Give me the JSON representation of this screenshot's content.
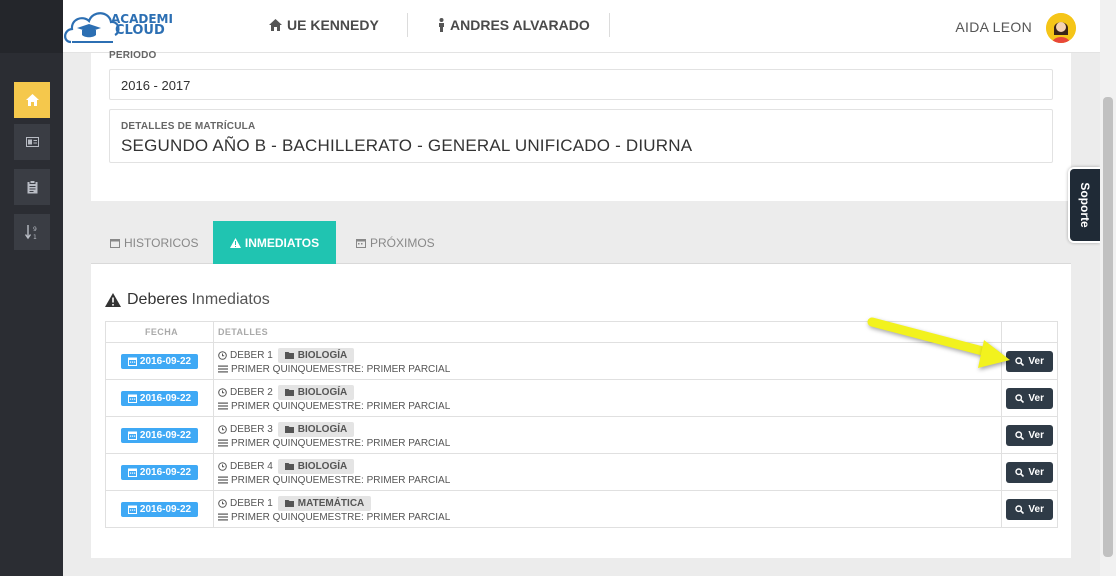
{
  "header": {
    "logo_line1": "ACADEMI",
    "logo_line2": "CLOUD",
    "school": "UE KENNEDY",
    "student": "ANDRES ALVARADO",
    "user": "AIDA LEON"
  },
  "sidebar": {
    "items": [
      {
        "icon": "home-icon",
        "active": true
      },
      {
        "icon": "id-card-icon"
      },
      {
        "icon": "clipboard-icon"
      },
      {
        "icon": "sort-numeric-icon"
      }
    ]
  },
  "soporte": "Soporte",
  "matricula": {
    "periodo_label": "PERIODO",
    "periodo_value": "2016 - 2017",
    "detalles_label": "DETALLES DE MATRÍCULA",
    "detalles_value": "SEGUNDO AÑO B - BACHILLERATO - GENERAL UNIFICADO - DIURNA"
  },
  "tabs": [
    {
      "label": "HISTORICOS"
    },
    {
      "label": "INMEDIATOS",
      "active": true
    },
    {
      "label": "PRÓXIMOS"
    }
  ],
  "deberes": {
    "title_bold": "Deberes",
    "title_light": "Inmediatos",
    "columns": [
      "FECHA",
      "DETALLES",
      ""
    ],
    "ver_label": "Ver",
    "rows": [
      {
        "fecha": "2016-09-22",
        "deber": "DEBER 1",
        "materia": "BIOLOGÍA",
        "parcial": "PRIMER QUINQUEMESTRE: PRIMER PARCIAL"
      },
      {
        "fecha": "2016-09-22",
        "deber": "DEBER 2",
        "materia": "BIOLOGÍA",
        "parcial": "PRIMER QUINQUEMESTRE: PRIMER PARCIAL"
      },
      {
        "fecha": "2016-09-22",
        "deber": "DEBER 3",
        "materia": "BIOLOGÍA",
        "parcial": "PRIMER QUINQUEMESTRE: PRIMER PARCIAL"
      },
      {
        "fecha": "2016-09-22",
        "deber": "DEBER 4",
        "materia": "BIOLOGÍA",
        "parcial": "PRIMER QUINQUEMESTRE: PRIMER PARCIAL"
      },
      {
        "fecha": "2016-09-22",
        "deber": "DEBER 1",
        "materia": "MATEMÁTICA",
        "parcial": "PRIMER QUINQUEMESTRE: PRIMER PARCIAL"
      }
    ]
  },
  "colors": {
    "accent": "#20c4b1",
    "date_badge": "#3fa9f5",
    "button": "#2f3b47",
    "active_side": "#f5c84c",
    "arrow": "#f2f21e"
  }
}
